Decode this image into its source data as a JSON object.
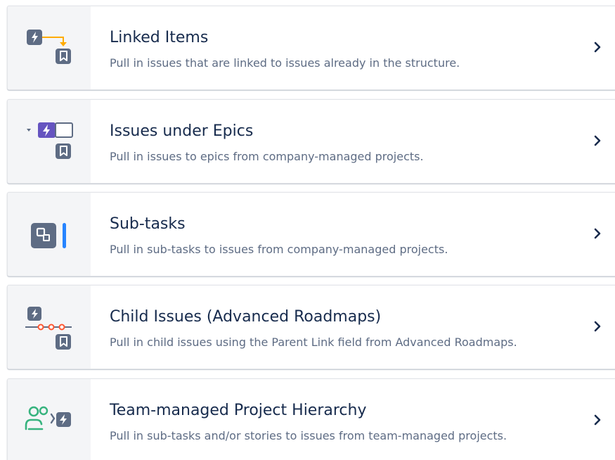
{
  "options": [
    {
      "title": "Linked Items",
      "description": "Pull in issues that are linked to issues already in the structure.",
      "icon": "linked-items-icon"
    },
    {
      "title": "Issues under Epics",
      "description": "Pull in issues to epics from company-managed projects.",
      "icon": "epic-issues-icon"
    },
    {
      "title": "Sub-tasks",
      "description": "Pull in sub-tasks to issues from company-managed projects.",
      "icon": "subtask-icon"
    },
    {
      "title": "Child Issues (Advanced Roadmaps)",
      "description": "Pull in child issues using the Parent Link field from Advanced Roadmaps.",
      "icon": "roadmap-hierarchy-icon"
    },
    {
      "title": "Team-managed Project Hierarchy",
      "description": "Pull in sub-tasks and/or stories to issues from team-managed projects.",
      "icon": "team-hierarchy-icon"
    }
  ],
  "colors": {
    "title_text": "#172b4d",
    "description_text": "#5e6c84",
    "icon_panel_bg": "#f4f5f7",
    "issue_gray": "#5e6c84",
    "link_orange": "#ffab00",
    "epic_purple": "#6554c0",
    "subtask_blue": "#2684ff",
    "roadmap_red": "#ff5630",
    "team_green": "#36b37e"
  }
}
